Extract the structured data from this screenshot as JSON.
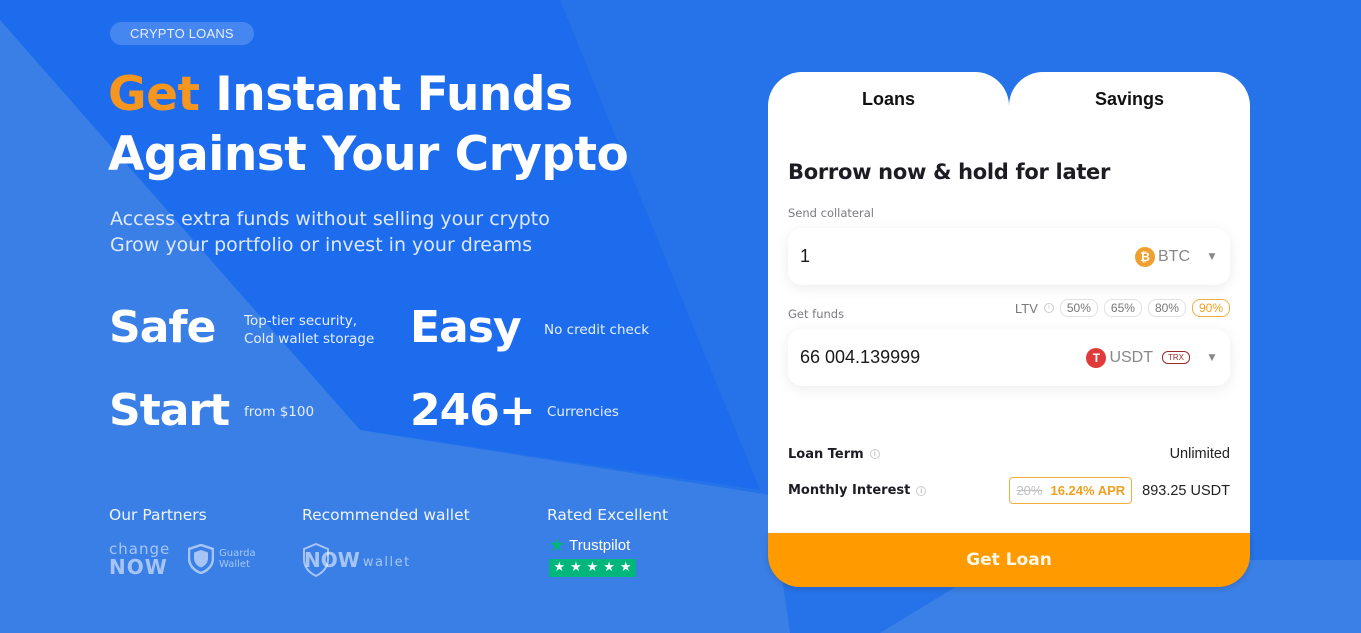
{
  "colors": {
    "accent_orange": "#f7961e",
    "button_orange": "#ff9a00",
    "background_blue": "#2672e8",
    "trustpilot_green": "#00b67a"
  },
  "hero": {
    "badge": "CRYPTO LOANS",
    "headline_accent": "Get",
    "headline_rest_line1": " Instant Funds",
    "headline_line2": "Against Your Crypto",
    "subtitle_line1": "Access extra funds without selling your crypto",
    "subtitle_line2": "Grow your portfolio or invest in your dreams"
  },
  "features": [
    {
      "title": "Safe",
      "desc_line1": "Top-tier security,",
      "desc_line2": "Cold wallet storage"
    },
    {
      "title": "Easy",
      "desc_line1": "No credit check",
      "desc_line2": ""
    },
    {
      "title": "Start",
      "desc_line1": "from $100",
      "desc_line2": ""
    },
    {
      "title": "246+",
      "desc_line1": "Currencies",
      "desc_line2": ""
    }
  ],
  "partners": {
    "partners_label": "Our Partners",
    "wallet_label": "Recommended wallet",
    "rated_label": "Rated Excellent",
    "changenow_line1": "change",
    "changenow_line2": "NOW",
    "guarda_line1": "Guarda",
    "guarda_line2": "Wallet",
    "nowwallet_now": "NOW",
    "nowwallet_wallet": "wallet",
    "trustpilot_name": "Trustpilot",
    "trustpilot_rating_stars": 5
  },
  "card": {
    "tabs": [
      {
        "label": "Loans",
        "active": true
      },
      {
        "label": "Savings",
        "active": false
      }
    ],
    "title": "Borrow now & hold for later",
    "collateral": {
      "label": "Send collateral",
      "value": "1",
      "coin": "BTC",
      "coin_icon": "bitcoin-icon"
    },
    "funds": {
      "label": "Get funds",
      "value": "66 004.139999",
      "coin": "USDT",
      "coin_icon": "tether-icon",
      "network": "TRX"
    },
    "ltv": {
      "label": "LTV",
      "options": [
        "50%",
        "65%",
        "80%",
        "90%"
      ],
      "selected": "90%"
    },
    "loan_term": {
      "label": "Loan Term",
      "value": "Unlimited"
    },
    "monthly_interest": {
      "label": "Monthly Interest",
      "old_rate": "20%",
      "new_rate": "16.24% APR",
      "amount": "893.25 USDT"
    },
    "cta": "Get Loan"
  }
}
